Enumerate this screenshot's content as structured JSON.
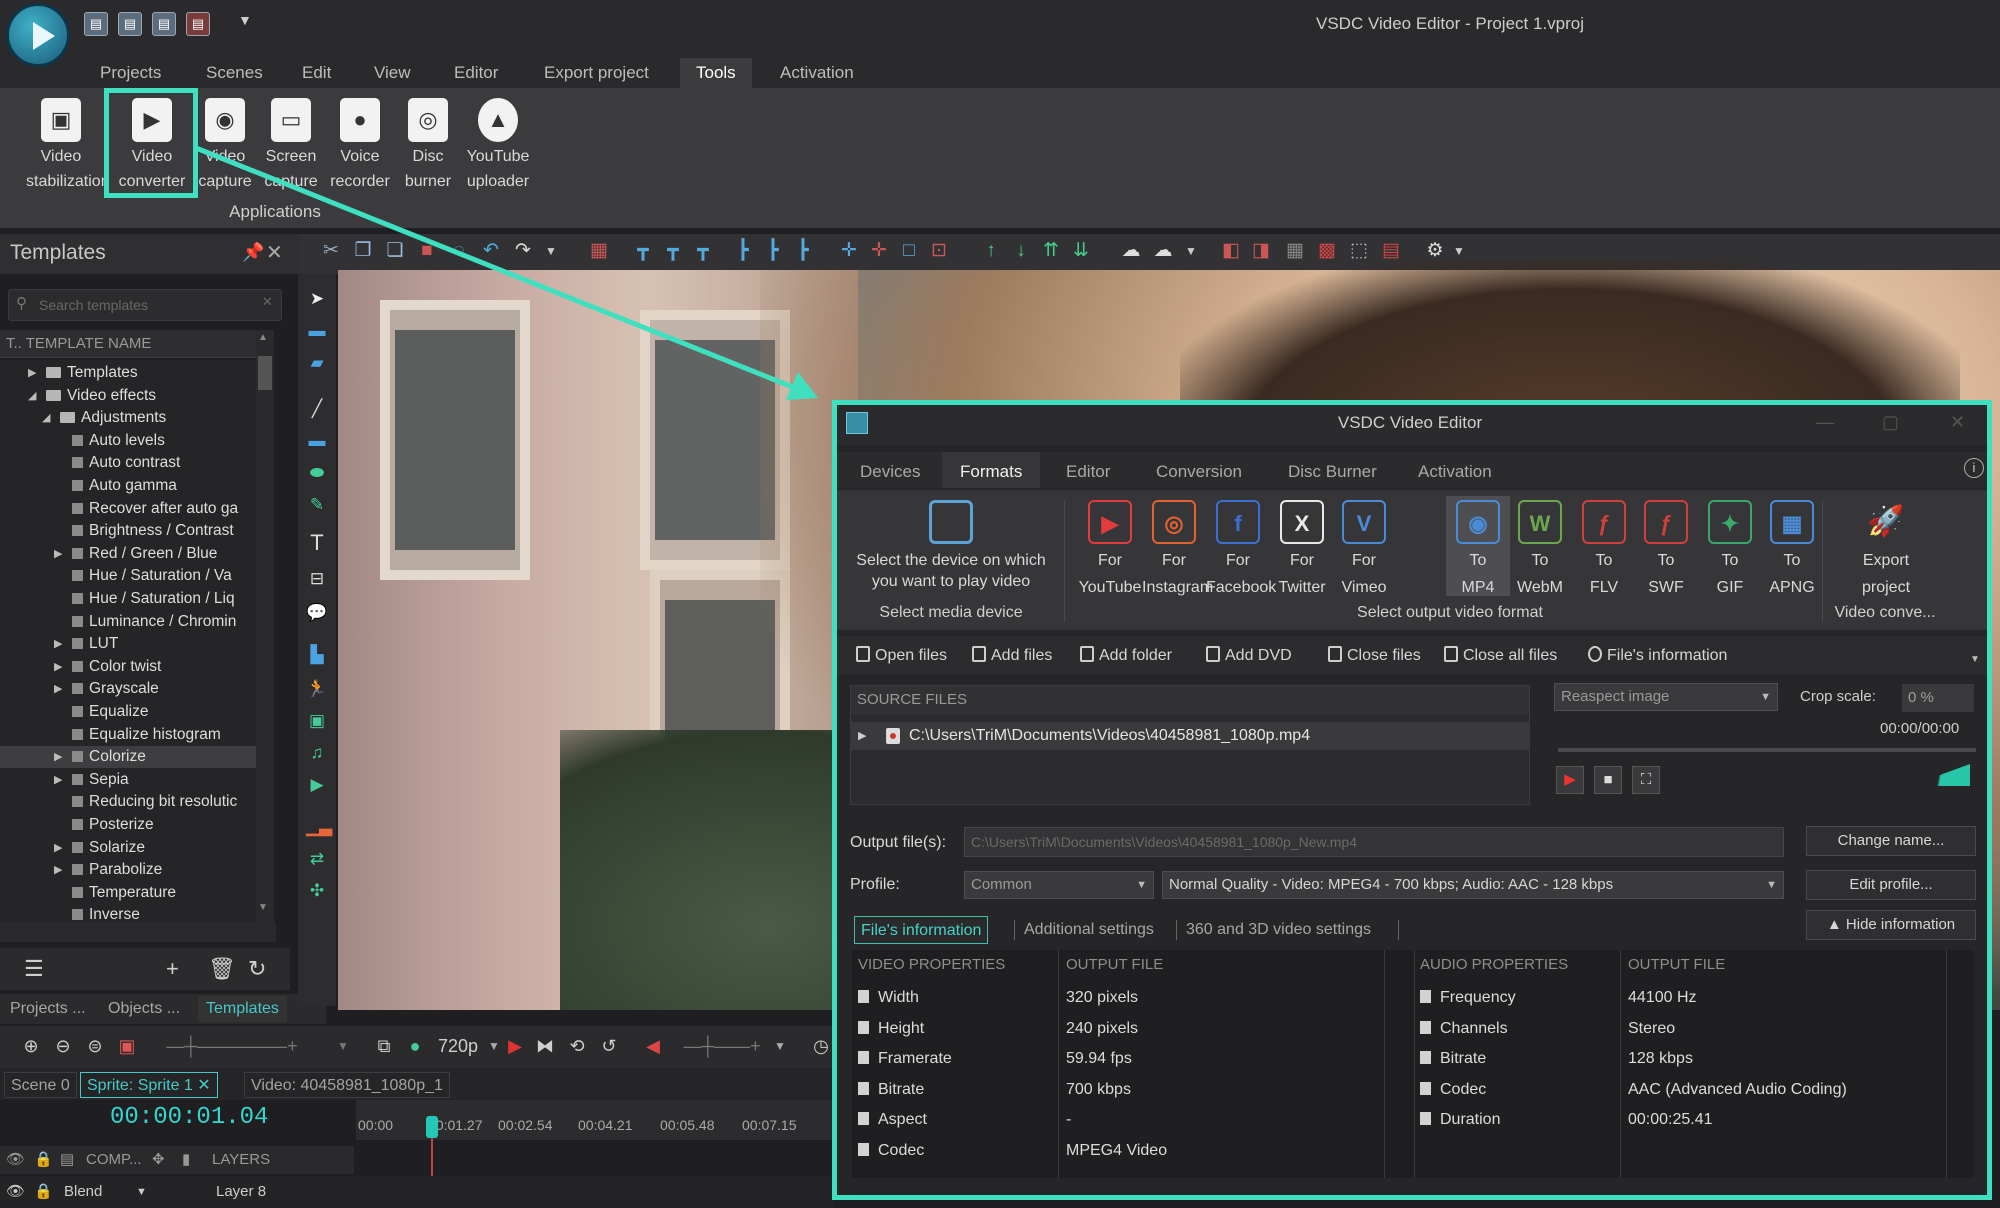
{
  "app": {
    "title": "VSDC Video Editor - Project 1.vproj"
  },
  "menu": [
    "Projects",
    "Scenes",
    "Edit",
    "View",
    "Editor",
    "Export project",
    "Tools",
    "Activation"
  ],
  "menu_active": "Tools",
  "ribbon": {
    "buttons": [
      {
        "label1": "Video",
        "label2": "stabilization",
        "icon": "video-stabilization-icon"
      },
      {
        "label1": "Video",
        "label2": "converter",
        "icon": "video-converter-icon"
      },
      {
        "label1": "Video",
        "label2": "capture",
        "icon": "video-capture-icon"
      },
      {
        "label1": "Screen",
        "label2": "capture",
        "icon": "screen-capture-icon"
      },
      {
        "label1": "Voice",
        "label2": "recorder",
        "icon": "microphone-icon"
      },
      {
        "label1": "Disc",
        "label2": "burner",
        "icon": "disc-icon"
      },
      {
        "label1": "YouTube",
        "label2": "uploader",
        "icon": "upload-icon"
      }
    ],
    "group_caption": "Applications"
  },
  "templates_panel": {
    "title": "Templates",
    "search_placeholder": "Search templates",
    "column_header": "TEMPLATE NAME",
    "column_prefix": "T..",
    "tree": [
      {
        "label": "Templates"
      },
      {
        "label": "Video effects"
      },
      {
        "label": "Adjustments"
      },
      {
        "label": "Auto levels"
      },
      {
        "label": "Auto contrast"
      },
      {
        "label": "Auto gamma"
      },
      {
        "label": "Recover after auto ga"
      },
      {
        "label": "Brightness / Contrast"
      },
      {
        "label": "Red / Green / Blue"
      },
      {
        "label": "Hue / Saturation / Va"
      },
      {
        "label": "Hue / Saturation / Liq"
      },
      {
        "label": "Luminance / Chromin"
      },
      {
        "label": "LUT"
      },
      {
        "label": "Color twist"
      },
      {
        "label": "Grayscale"
      },
      {
        "label": "Equalize"
      },
      {
        "label": "Equalize histogram"
      },
      {
        "label": "Colorize"
      },
      {
        "label": "Sepia"
      },
      {
        "label": "Reducing bit resolutic"
      },
      {
        "label": "Posterize"
      },
      {
        "label": "Solarize"
      },
      {
        "label": "Parabolize"
      },
      {
        "label": "Temperature"
      },
      {
        "label": "Inverse"
      }
    ],
    "selected": "Colorize"
  },
  "bottom_tabs": [
    "Projects ...",
    "Objects ...",
    "Templates"
  ],
  "timeline": {
    "resolution": "720p",
    "tabs": [
      "Scene 0",
      "Sprite: Sprite 1",
      "Video: 40458981_1080p_1"
    ],
    "time": "00:00:01.04",
    "ruler": [
      "00:00",
      "00:01.27",
      "00:02.54",
      "00:04.21",
      "00:05.48",
      "00:07.15"
    ],
    "layer_header": {
      "comp": "COMP...",
      "layers": "LAYERS"
    },
    "layer_row": {
      "blend": "Blend",
      "layer": "Layer 8"
    }
  },
  "dialog": {
    "title": "VSDC Video Editor",
    "tabs": [
      "Devices",
      "Formats",
      "Editor",
      "Conversion",
      "Disc Burner",
      "Activation"
    ],
    "active_tab": "Formats",
    "media_device_label": "Select the device on which you want to play video",
    "media_device_caption": "Select media device",
    "formats": [
      {
        "l1": "For",
        "l2": "YouTube",
        "icon": "youtube-icon",
        "color": "#e23b3b",
        "glyph": "▶"
      },
      {
        "l1": "For",
        "l2": "Instagram",
        "icon": "instagram-icon",
        "color": "#e0622f",
        "glyph": "◎"
      },
      {
        "l1": "For",
        "l2": "Facebook",
        "icon": "facebook-icon",
        "color": "#3b6fd6",
        "glyph": "f"
      },
      {
        "l1": "For",
        "l2": "Twitter",
        "icon": "x-icon",
        "color": "#e8e8e8",
        "glyph": "X"
      },
      {
        "l1": "For",
        "l2": "Vimeo",
        "icon": "vimeo-icon",
        "color": "#4a8bd8",
        "glyph": "V"
      },
      {
        "l1": "To",
        "l2": "MP4",
        "icon": "mp4-icon",
        "color": "#4a8bd8",
        "glyph": "◉"
      },
      {
        "l1": "To",
        "l2": "WebM",
        "icon": "webm-icon",
        "color": "#6aa84f",
        "glyph": "W"
      },
      {
        "l1": "To",
        "l2": "FLV",
        "icon": "flv-icon",
        "color": "#d0403a",
        "glyph": "ƒ"
      },
      {
        "l1": "To",
        "l2": "SWF",
        "icon": "swf-icon",
        "color": "#d0403a",
        "glyph": "ƒ"
      },
      {
        "l1": "To",
        "l2": "GIF",
        "icon": "gif-icon",
        "color": "#3aa86b",
        "glyph": "✦"
      },
      {
        "l1": "To",
        "l2": "APNG",
        "icon": "apng-icon",
        "color": "#4a8bd8",
        "glyph": "▦"
      }
    ],
    "formats_caption": "Select output video format",
    "export": {
      "l1": "Export",
      "l2": "project",
      "caption": "Video conve..."
    },
    "files_toolbar": [
      "Open files",
      "Add files",
      "Add folder",
      "Add DVD",
      "Close files",
      "Close all files",
      "File's information"
    ],
    "source_header": "SOURCE FILES",
    "source_file": "C:\\Users\\TriM\\Documents\\Videos\\40458981_1080p.mp4",
    "resize_mode": "Reaspect image",
    "crop_label": "Crop scale:",
    "crop_value": "0 %",
    "preview_time": "00:00/00:00",
    "output_label": "Output file(s):",
    "output_value": "C:\\Users\\TriM\\Documents\\Videos\\40458981_1080p_New.mp4",
    "change_name": "Change name...",
    "profile_label": "Profile:",
    "profile_value": "Common",
    "quality_value": "Normal Quality - Video: MPEG4 - 700 kbps; Audio: AAC - 128 kbps",
    "edit_profile": "Edit profile...",
    "info_tabs": [
      "File's information",
      "Additional settings",
      "360 and 3D video settings"
    ],
    "hide_info": "Hide information",
    "video_props_header": "VIDEO PROPERTIES",
    "audio_props_header": "AUDIO PROPERTIES",
    "output_file_header": "OUTPUT FILE",
    "video_props": [
      {
        "k": "Width",
        "v": "320 pixels"
      },
      {
        "k": "Height",
        "v": "240 pixels"
      },
      {
        "k": "Framerate",
        "v": "59.94 fps"
      },
      {
        "k": "Bitrate",
        "v": "700 kbps"
      },
      {
        "k": "Aspect",
        "v": "-"
      },
      {
        "k": "Codec",
        "v": "MPEG4 Video"
      }
    ],
    "audio_props": [
      {
        "k": "Frequency",
        "v": "44100 Hz"
      },
      {
        "k": "Channels",
        "v": "Stereo"
      },
      {
        "k": "Bitrate",
        "v": "128 kbps"
      },
      {
        "k": "Codec",
        "v": "AAC (Advanced Audio Coding)"
      },
      {
        "k": "Duration",
        "v": "00:00:25.41"
      }
    ]
  },
  "colors": {
    "accent": "#3fe0bf",
    "panel": "#262628",
    "time": "#35d6cf"
  }
}
